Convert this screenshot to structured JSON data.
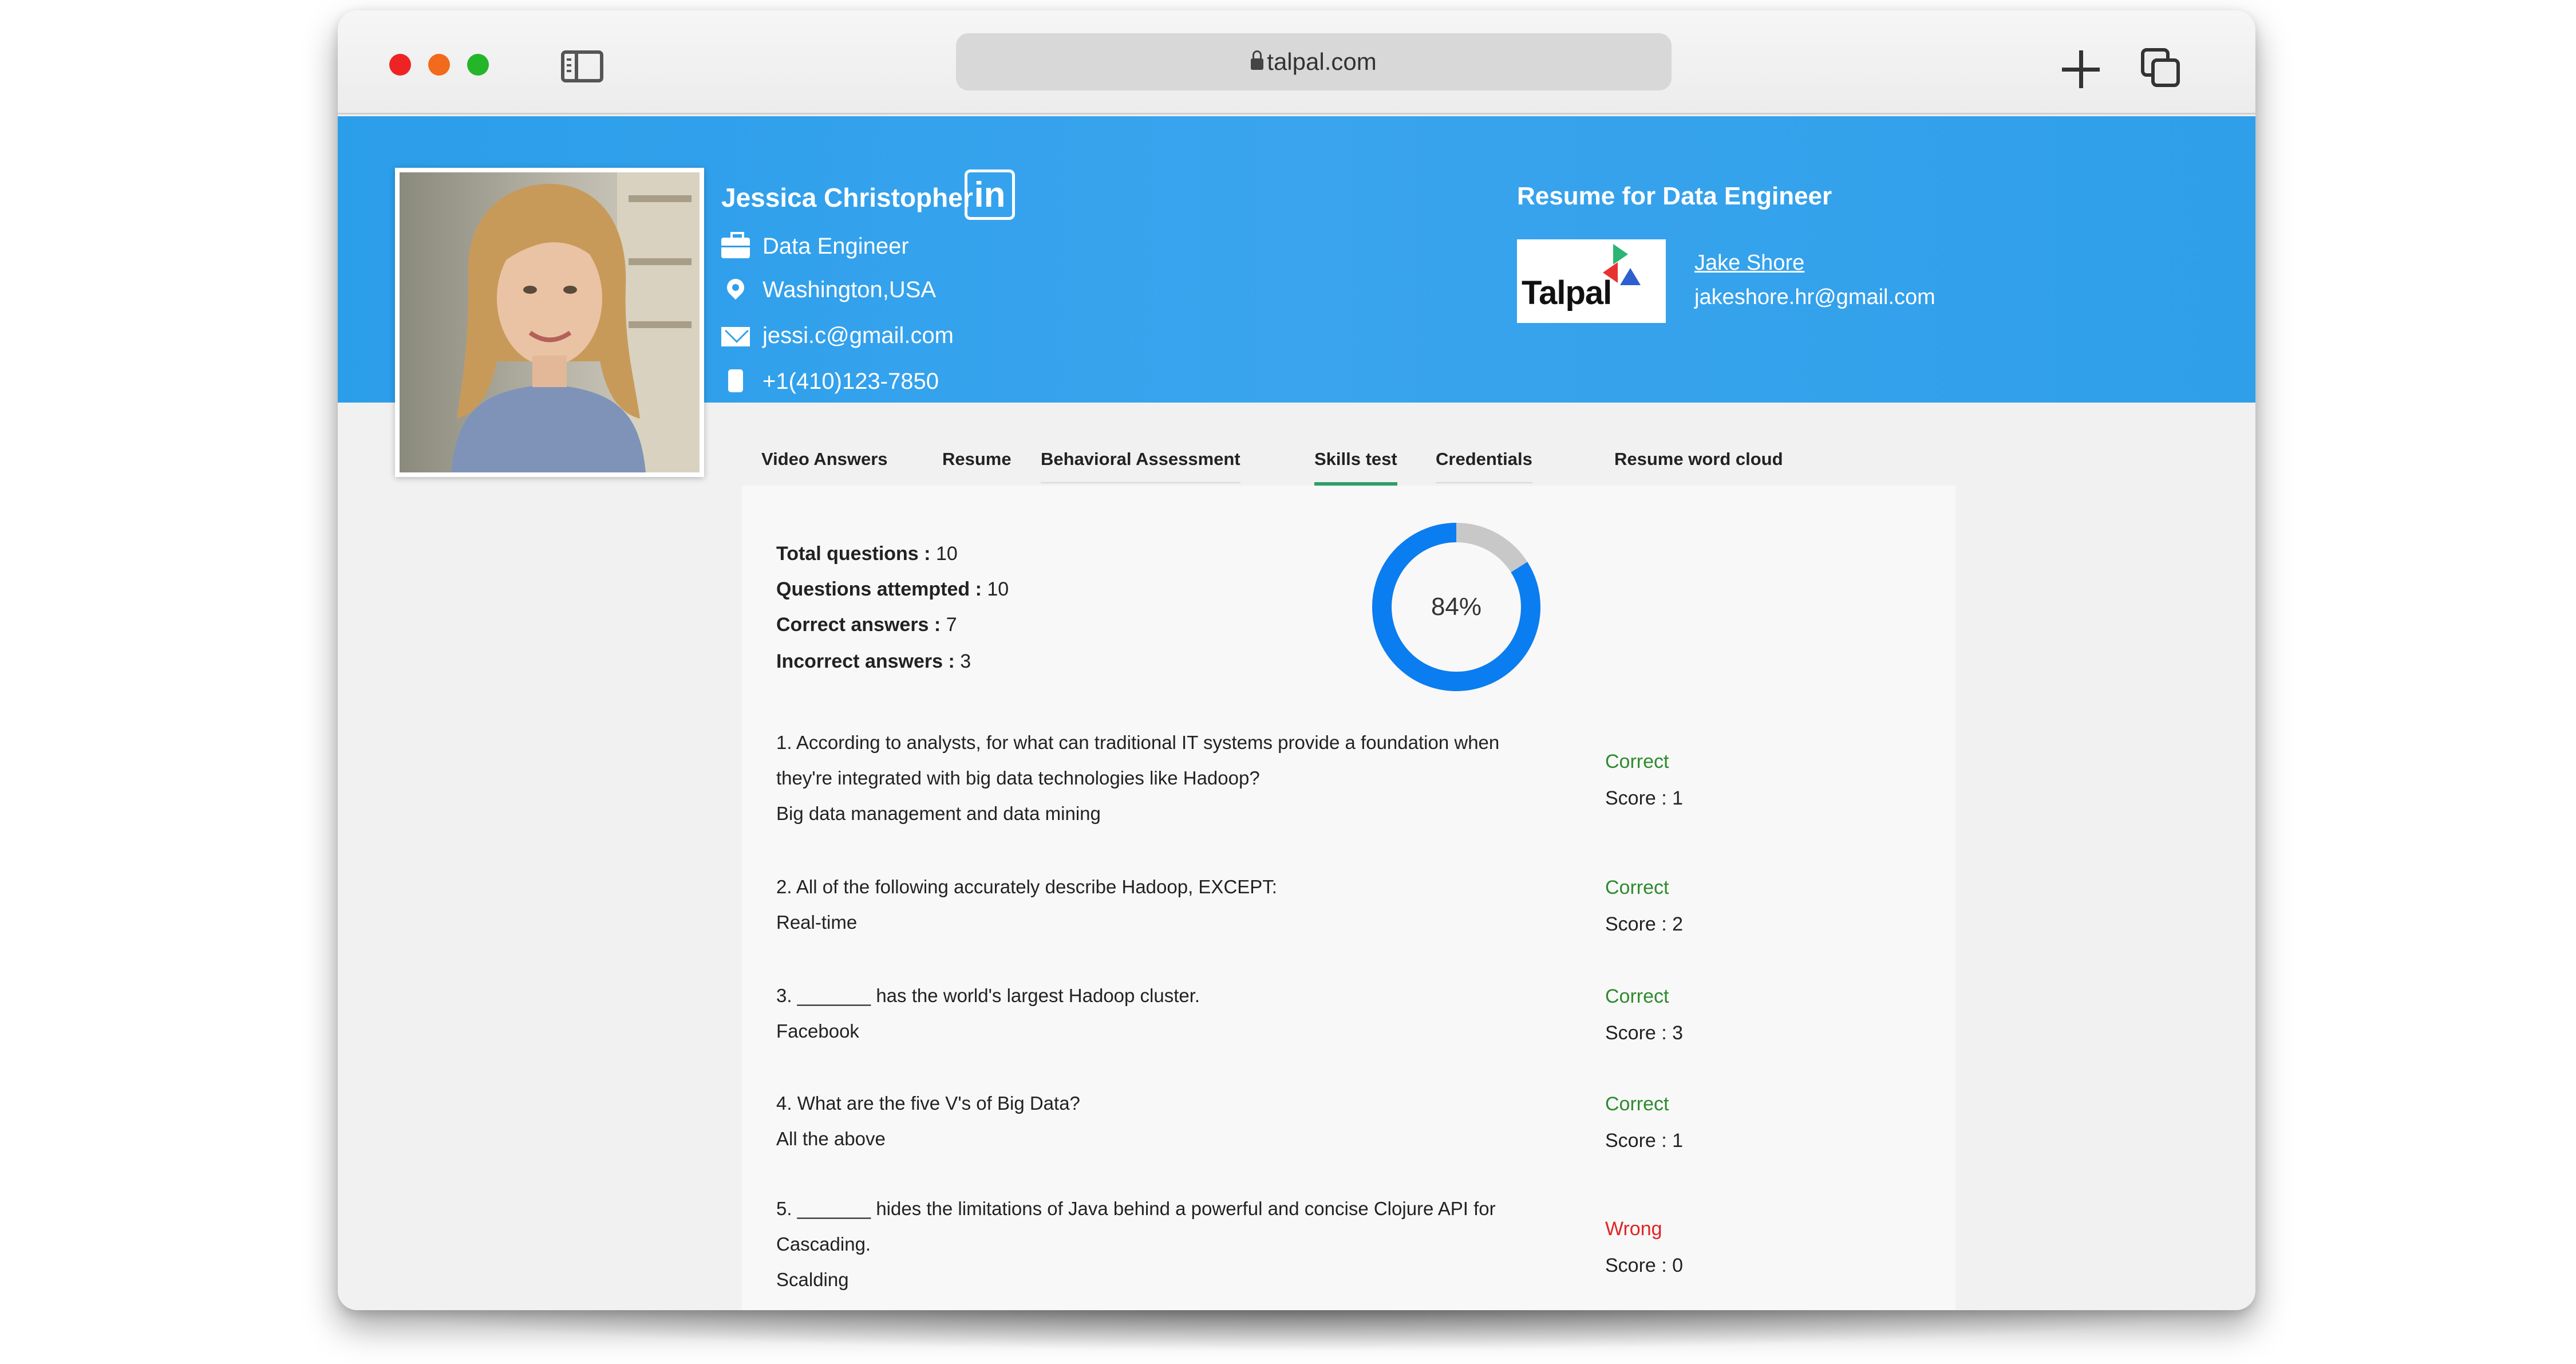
{
  "browser": {
    "url": "talpal.com"
  },
  "candidate": {
    "name": "Jessica Christopher",
    "linkedin_label": "in",
    "title": "Data Engineer",
    "location": "Washington,USA",
    "email": "jessi.c@gmail.com",
    "phone": "+1(410)123-7850"
  },
  "resume_header": {
    "title": "Resume for Data Engineer",
    "logo_text": "Talpal",
    "recruiter_name": "Jake Shore",
    "recruiter_email": "jakeshore.hr@gmail.com"
  },
  "tabs": [
    {
      "label": "Video Answers"
    },
    {
      "label": "Resume"
    },
    {
      "label": "Behavioral Assessment"
    },
    {
      "label": "Skills test",
      "active": true
    },
    {
      "label": "Credentials"
    },
    {
      "label": "Resume word cloud"
    }
  ],
  "summary": {
    "total_label": "Total questions :",
    "total_value": "10",
    "attempted_label": "Questions attempted :",
    "attempted_value": "10",
    "correct_label": "Correct answers :",
    "correct_value": "7",
    "incorrect_label": "Incorrect answers :",
    "incorrect_value": "3",
    "percent": 84,
    "percent_label": "84%",
    "ring_color": "#0a7df0",
    "ring_remainder_color": "#c8c8c8"
  },
  "questions": [
    {
      "line1": "1. According to analysts, for what can traditional IT systems provide a foundation when",
      "line2": "they're integrated with big data technologies like Hadoop?",
      "answer": "Big data management and data mining",
      "status": "Correct",
      "score": "Score : 1"
    },
    {
      "line1": "2. All of the following accurately describe Hadoop, EXCEPT:",
      "answer": "Real-time",
      "status": "Correct",
      "score": "Score : 2"
    },
    {
      "line1": "3. _______ has the world's largest Hadoop cluster.",
      "answer": "Facebook",
      "status": "Correct",
      "score": "Score : 3"
    },
    {
      "line1": "4. What are the five V's of Big Data?",
      "answer": "All the above",
      "status": "Correct",
      "score": "Score : 1"
    },
    {
      "line1": "5. _______ hides the limitations of Java behind a powerful and concise Clojure API for",
      "line2": "Cascading.",
      "answer": "Scalding",
      "status": "Wrong",
      "score": "Score : 0"
    }
  ],
  "colors": {
    "banner": "#2b9eea",
    "correct": "#2e8a2e",
    "wrong": "#e02424",
    "active_tab": "#2ca065"
  }
}
